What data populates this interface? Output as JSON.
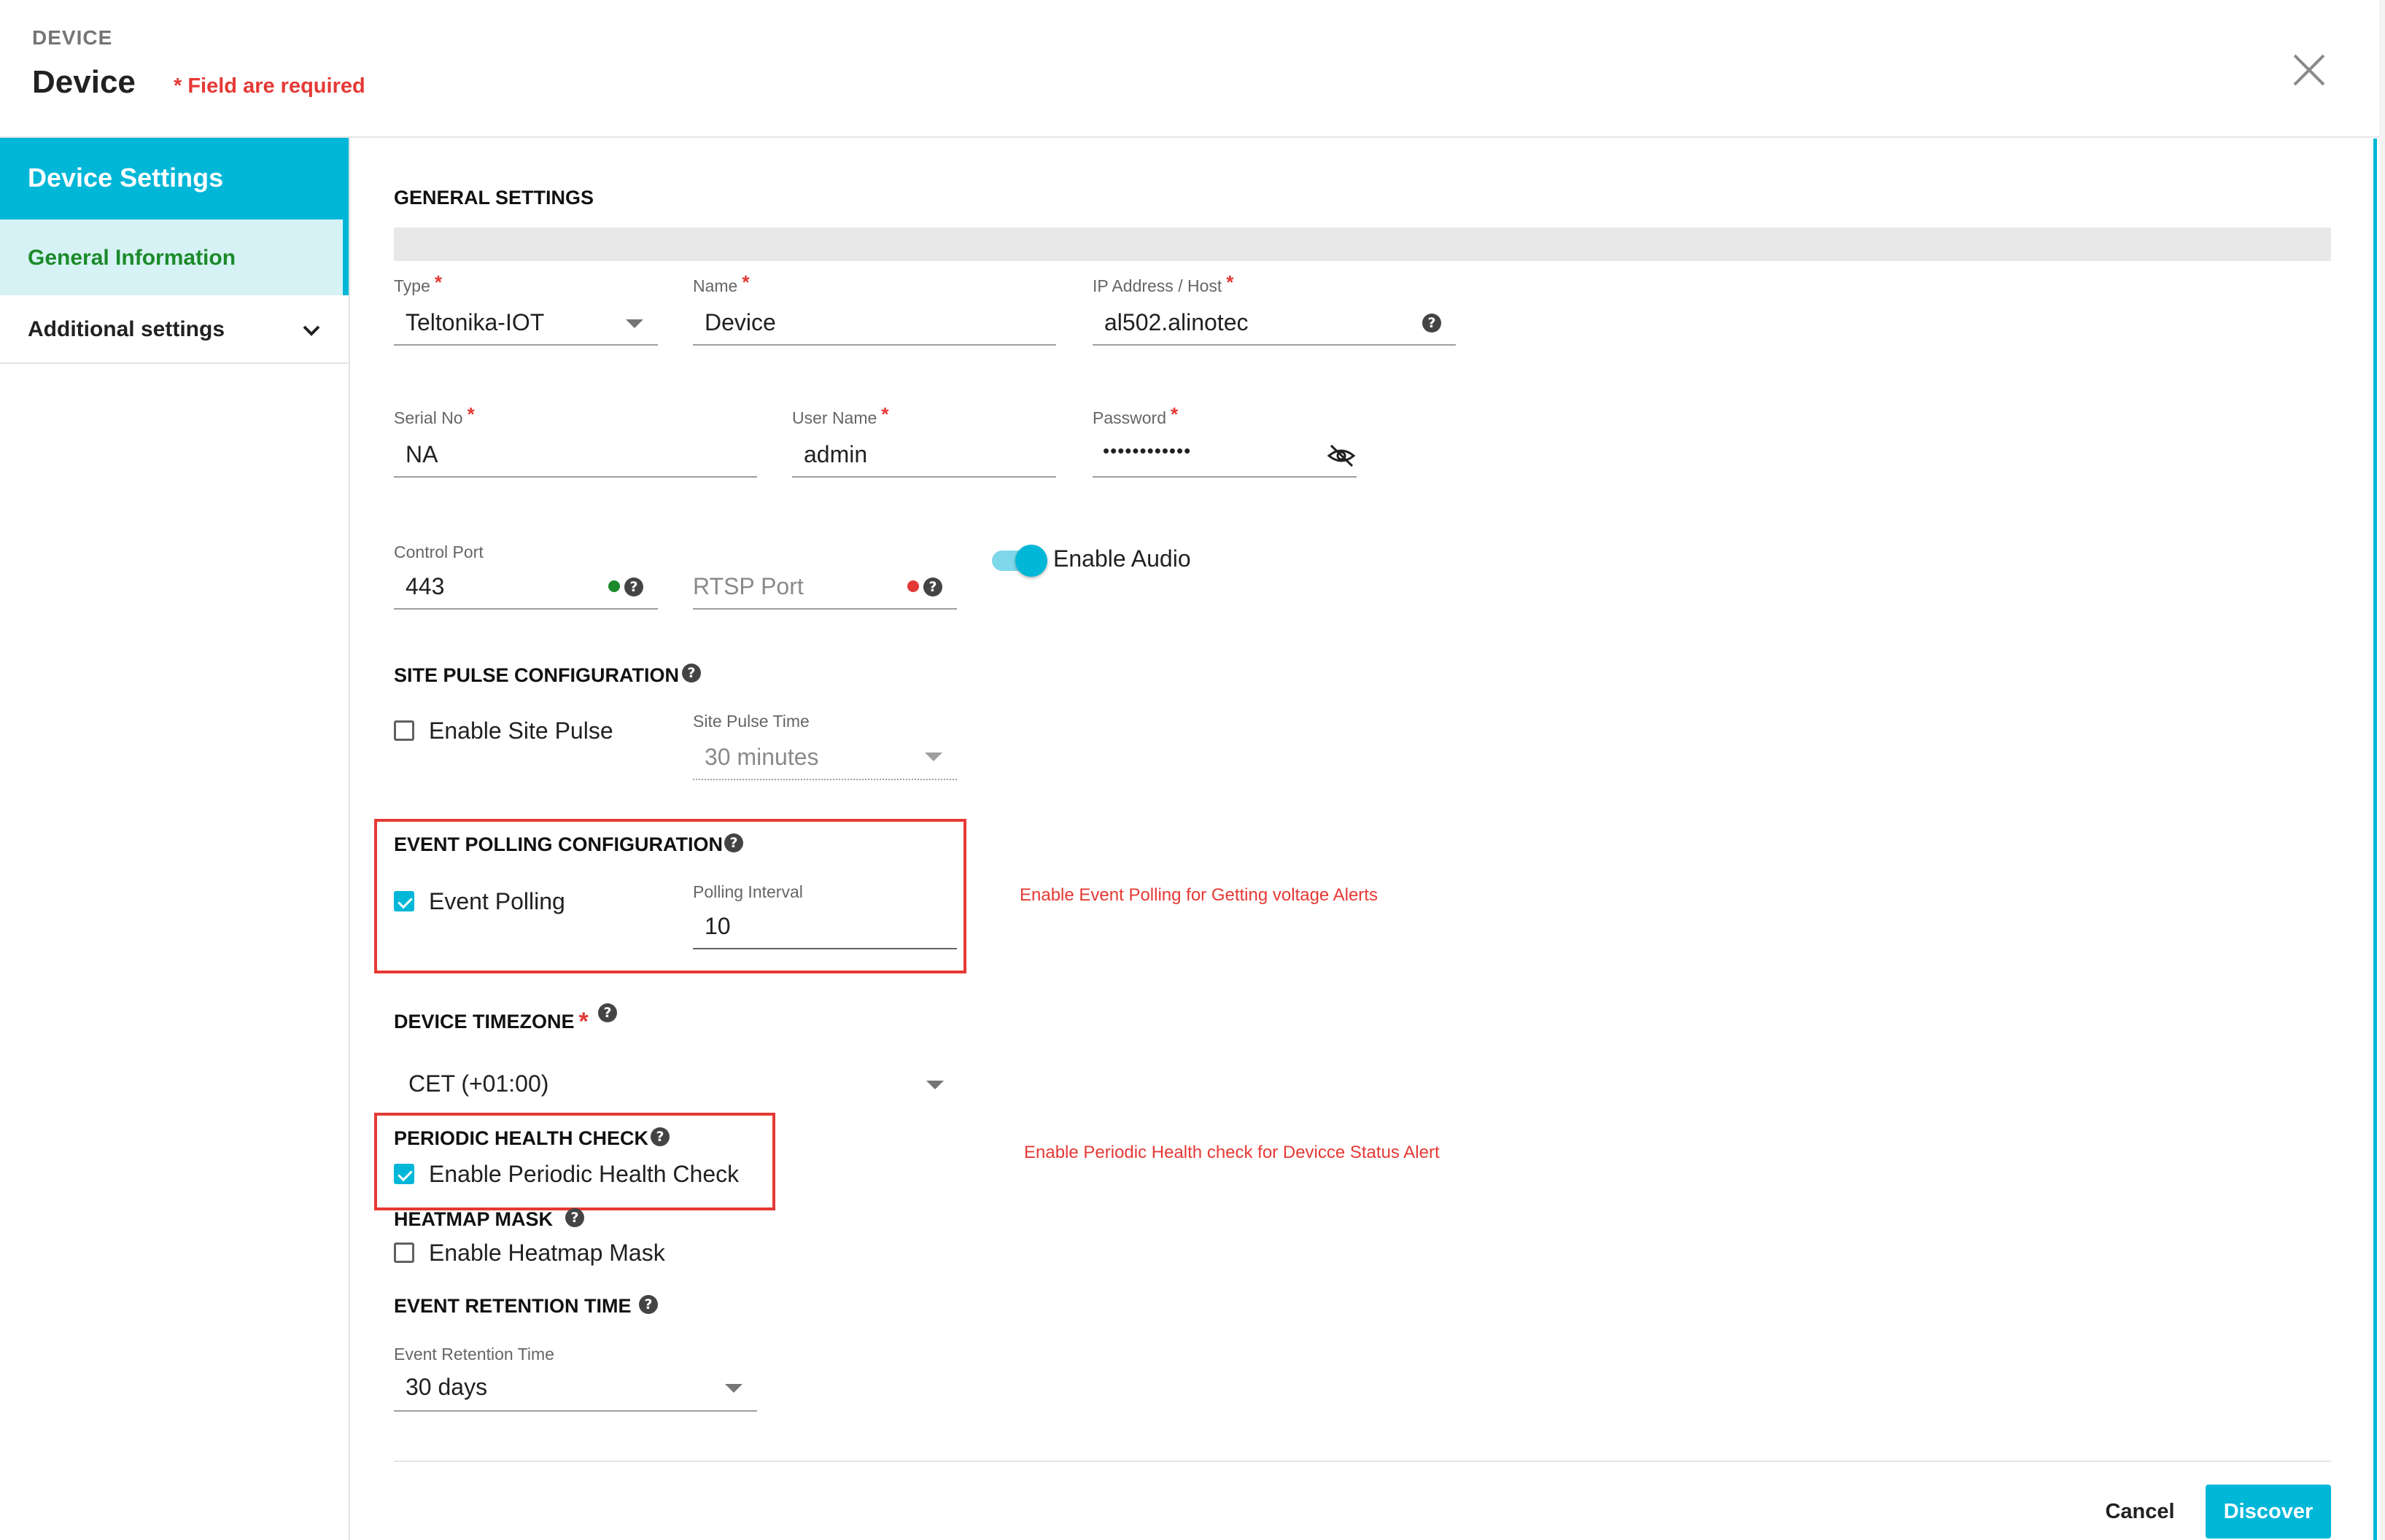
{
  "header": {
    "kicker": "DEVICE",
    "title": "Device",
    "required_note": "* Field are required"
  },
  "sidebar": {
    "title": "Device Settings",
    "items": [
      {
        "label": "General Information",
        "active": true
      },
      {
        "label": "Additional settings",
        "icon": "chevron-down-icon"
      }
    ]
  },
  "general": {
    "section_title": "GENERAL SETTINGS",
    "type": {
      "label": "Type",
      "required": "*",
      "value": "Teltonika-IOT"
    },
    "name": {
      "label": "Name",
      "required": "*",
      "value": "Device"
    },
    "ip": {
      "label": "IP Address / Host",
      "required": "*",
      "value": "al502.alinotec"
    },
    "serial": {
      "label": "Serial No",
      "required": "*",
      "value": "NA"
    },
    "username": {
      "label": "User Name",
      "required": "*",
      "value": "admin"
    },
    "password": {
      "label": "Password",
      "required": "*",
      "value": "••••••••••••",
      "icon": "eye-off-icon"
    },
    "control_port": {
      "label": "Control Port",
      "value": "443",
      "status_color": "#1b8a2a"
    },
    "rtsp_port": {
      "placeholder": "RTSP Port",
      "status_color": "#e53935"
    },
    "enable_audio": {
      "label": "Enable Audio",
      "on": true
    }
  },
  "site_pulse": {
    "section_title": "SITE PULSE CONFIGURATION",
    "checkbox_label": "Enable Site Pulse",
    "checked": false,
    "time_label": "Site Pulse Time",
    "time_value": "30 minutes"
  },
  "event_polling": {
    "section_title": "EVENT POLLING CONFIGURATION",
    "checkbox_label": "Event Polling",
    "checked": true,
    "interval_label": "Polling Interval",
    "interval_value": "10",
    "note": "Enable  Event Polling for  Getting voltage Alerts"
  },
  "timezone": {
    "section_title": "DEVICE TIMEZONE",
    "required": "*",
    "value": "CET (+01:00)"
  },
  "health_check": {
    "section_title": "PERIODIC HEALTH CHECK",
    "checkbox_label": "Enable Periodic Health Check",
    "checked": true,
    "note": "Enable  Periodic  Health check for Devicce Status Alert"
  },
  "heatmap": {
    "section_title": "HEATMAP MASK",
    "checkbox_label": "Enable Heatmap Mask",
    "checked": false
  },
  "retention": {
    "section_title": "EVENT RETENTION TIME",
    "field_label": "Event Retention Time",
    "value": "30 days"
  },
  "footer": {
    "cancel_label": "Cancel",
    "discover_label": "Discover"
  },
  "colors": {
    "accent": "#00b7d8",
    "required": "#e53935",
    "active_text": "#1b8a2a"
  }
}
